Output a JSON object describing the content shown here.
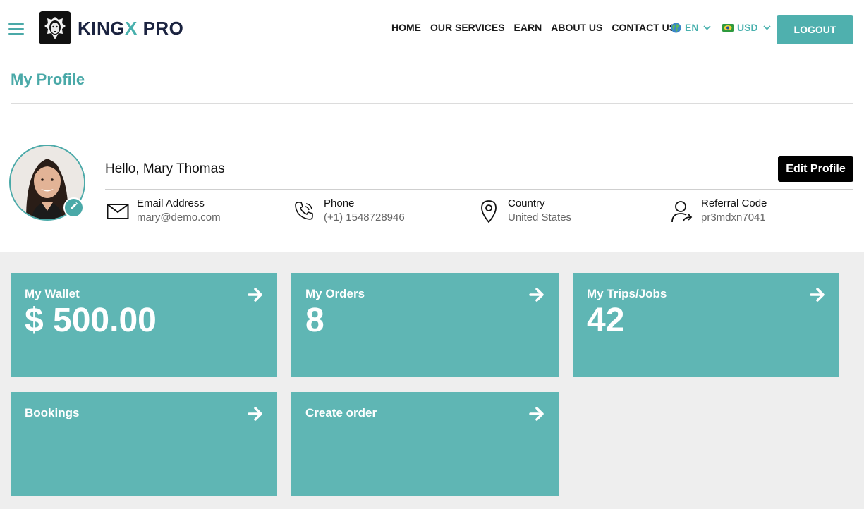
{
  "brand": {
    "name_part1": "KING",
    "name_x": "X",
    "name_part2": " PRO"
  },
  "nav": {
    "items": [
      "HOME",
      "OUR SERVICES",
      "EARN",
      "ABOUT US",
      "CONTACT US"
    ],
    "language": "EN",
    "currency": "USD",
    "logout_label": "LOGOUT"
  },
  "page": {
    "title": "My Profile"
  },
  "profile": {
    "greeting": "Hello, Mary Thomas",
    "edit_label": "Edit Profile",
    "email": {
      "label": "Email Address",
      "value": "mary@demo.com"
    },
    "phone": {
      "label": "Phone",
      "value": "(+1) 1548728946"
    },
    "country": {
      "label": "Country",
      "value": "United States"
    },
    "referral": {
      "label": "Referral Code",
      "value": "pr3mdxn7041"
    }
  },
  "tiles": [
    {
      "title": "My Wallet",
      "value": "$ 500.00"
    },
    {
      "title": "My Orders",
      "value": "8"
    },
    {
      "title": "My Trips/Jobs",
      "value": "42"
    },
    {
      "title": "Bookings",
      "value": ""
    },
    {
      "title": "Create order",
      "value": ""
    }
  ],
  "colors": {
    "accent": "#4aa9a8",
    "tile": "#5fb6b4",
    "dark": "#1b2340"
  },
  "icons": [
    "menu-icon",
    "lion-logo-icon",
    "globe-icon",
    "chevron-down-icon",
    "flag-icon",
    "pencil-icon",
    "mail-icon",
    "phone-icon",
    "location-pin-icon",
    "user-share-icon",
    "arrow-right-icon"
  ]
}
